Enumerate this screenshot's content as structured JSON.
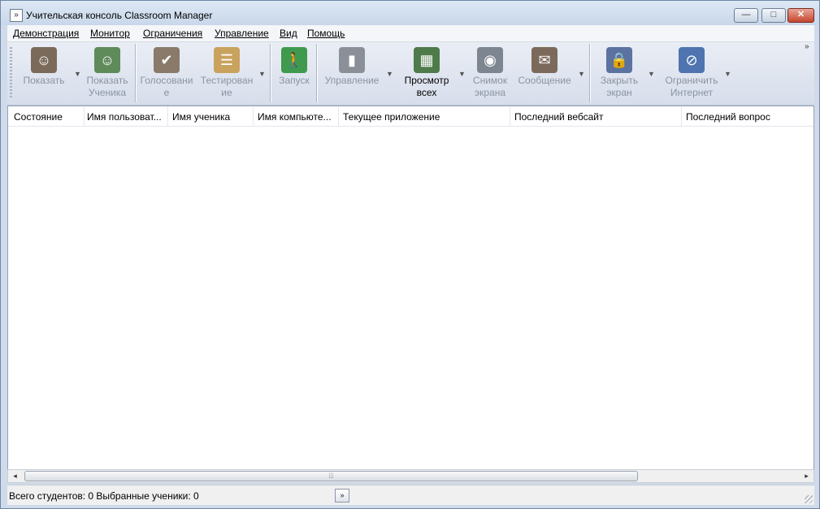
{
  "window": {
    "title": "Учительская консоль Classroom Manager",
    "app_icon": "»",
    "controls": {
      "minimize": "—",
      "maximize": "□",
      "close": "✕"
    }
  },
  "menu": [
    "Демонстрация",
    "Монитор",
    "Ограничения",
    "Управление",
    "Вид",
    "Помощь"
  ],
  "toolbar": {
    "items": [
      {
        "label1": "Показать",
        "label2": "",
        "icon": "teacher-present-icon",
        "enabled": false
      },
      {
        "label1": "Показать",
        "label2": "Ученика",
        "icon": "student-present-icon",
        "enabled": false
      },
      {
        "label1": "Голосовани",
        "label2": "е",
        "icon": "vote-icon",
        "enabled": false
      },
      {
        "label1": "Тестирован",
        "label2": "ие",
        "icon": "test-icon",
        "enabled": false
      },
      {
        "label1": "Запуск",
        "label2": "",
        "icon": "run-icon",
        "enabled": false
      },
      {
        "label1": "Управление",
        "label2": "",
        "icon": "remote-control-icon",
        "enabled": false
      },
      {
        "label1": "Просмотр",
        "label2": "всех",
        "icon": "view-all-icon",
        "enabled": true
      },
      {
        "label1": "Снимок",
        "label2": "экрана",
        "icon": "camera-icon",
        "enabled": false
      },
      {
        "label1": "Сообщение",
        "label2": "",
        "icon": "message-icon",
        "enabled": false
      },
      {
        "label1": "Закрыть",
        "label2": "экран",
        "icon": "lock-screen-icon",
        "enabled": false
      },
      {
        "label1": "Ограничить",
        "label2": "Интернет",
        "icon": "block-internet-icon",
        "enabled": false
      }
    ],
    "overflow": "»"
  },
  "columns": [
    "Состояние",
    "Имя пользоват...",
    "Имя ученика",
    "Имя компьюте...",
    "Текущее приложение",
    "Последний вебсайт",
    "Последний вопрос"
  ],
  "status": {
    "text": "Всего студентов: 0  Выбранные ученики: 0",
    "button": "»"
  },
  "scrollbar": {
    "left": "◂",
    "right": "▸",
    "grip": "⦙⦙⦙"
  }
}
